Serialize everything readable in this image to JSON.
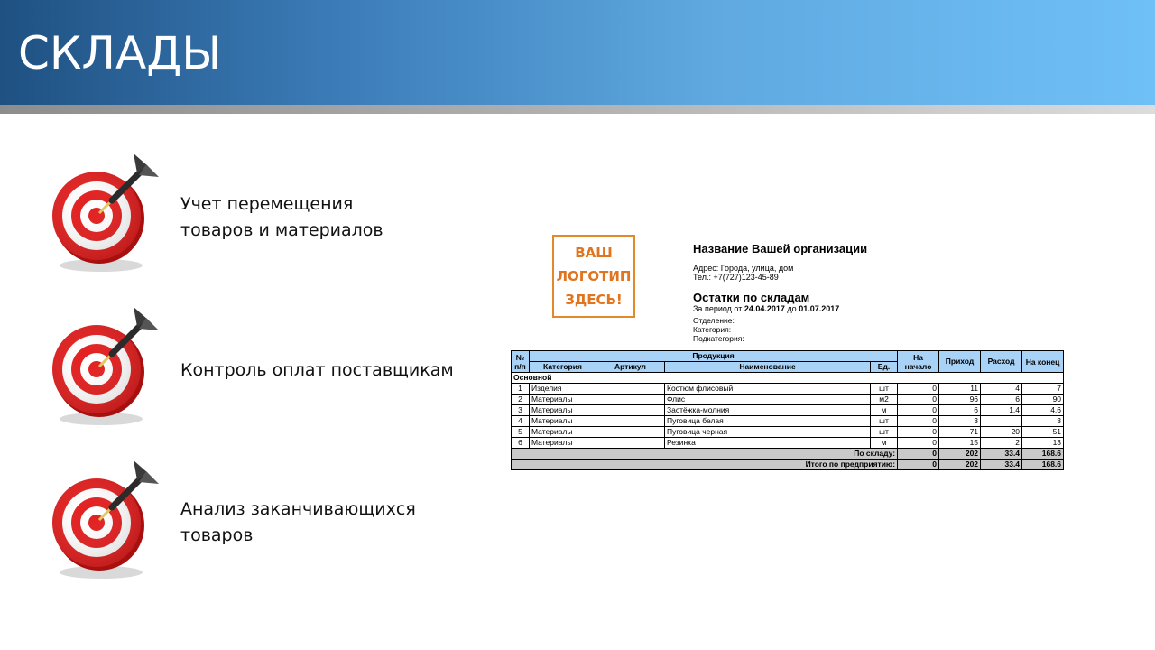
{
  "slide": {
    "title": "СКЛАДЫ",
    "colors": {
      "header_start": "#1f5182",
      "header_end": "#6fc0f7",
      "target_red": "#e31e1e",
      "logo_orange": "#e0741f",
      "table_header": "#a9d2f7"
    },
    "bullets": [
      {
        "icon": "target-dart-icon",
        "lines": [
          "Учет перемещения",
          "товаров и материалов"
        ]
      },
      {
        "icon": "target-dart-icon",
        "lines": [
          "Контроль оплат поставщикам"
        ]
      },
      {
        "icon": "target-dart-icon",
        "lines": [
          "Анализ заканчивающихся",
          "товаров"
        ]
      }
    ]
  },
  "report": {
    "logo_lines": [
      "ВАШ",
      "ЛОГОТИП",
      "ЗДЕСЬ!"
    ],
    "org_name": "Название Вашей организации",
    "address": "Адрес: Города, улица, дом",
    "phone": "Тел.: +7(727)123-45-89",
    "title": "Остатки по складам",
    "period_prefix": "За период от",
    "period_from": "24.04.2017",
    "period_mid": "до",
    "period_to": "01.07.2017",
    "filters": [
      "Отделение:",
      "Категория:",
      "Подкатегория:"
    ],
    "headers": {
      "num": "№ п/п",
      "products": "Продукция",
      "category": "Категория",
      "article": "Артикул",
      "name": "Наименование",
      "unit": "Ед.",
      "start": "На начало",
      "income": "Приход",
      "expense": "Расход",
      "end": "На конец"
    },
    "group_name": "Основной",
    "rows": [
      {
        "n": "1",
        "category": "Изделия",
        "article": "",
        "name": "Костюм флисовый",
        "unit": "шт",
        "start": "0",
        "income": "11",
        "expense": "4",
        "end": "7"
      },
      {
        "n": "2",
        "category": "Материалы",
        "article": "",
        "name": "Флис",
        "unit": "м2",
        "start": "0",
        "income": "96",
        "expense": "6",
        "end": "90"
      },
      {
        "n": "3",
        "category": "Материалы",
        "article": "",
        "name": "Застёжка-молния",
        "unit": "м",
        "start": "0",
        "income": "6",
        "expense": "1.4",
        "end": "4.6"
      },
      {
        "n": "4",
        "category": "Материалы",
        "article": "",
        "name": "Пуговица белая",
        "unit": "шт",
        "start": "0",
        "income": "3",
        "expense": "",
        "end": "3"
      },
      {
        "n": "5",
        "category": "Материалы",
        "article": "",
        "name": "Пуговица черная",
        "unit": "шт",
        "start": "0",
        "income": "71",
        "expense": "20",
        "end": "51"
      },
      {
        "n": "6",
        "category": "Материалы",
        "article": "",
        "name": "Резинка",
        "unit": "м",
        "start": "0",
        "income": "15",
        "expense": "2",
        "end": "13"
      }
    ],
    "totals": [
      {
        "label": "По складу:",
        "start": "0",
        "income": "202",
        "expense": "33.4",
        "end": "168.6"
      },
      {
        "label": "Итого по предприятию:",
        "start": "0",
        "income": "202",
        "expense": "33.4",
        "end": "168.6"
      }
    ]
  }
}
